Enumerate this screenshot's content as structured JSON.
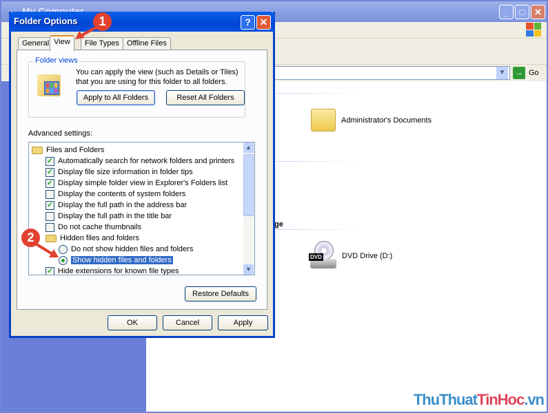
{
  "explorer": {
    "title": "My Computer",
    "address_go": "Go",
    "section_partial": "ge",
    "items": [
      {
        "label": "Administrator's Documents",
        "icon": "folder-icon"
      },
      {
        "label": "DVD Drive (D:)",
        "icon": "dvd-drive-icon"
      }
    ]
  },
  "dialog": {
    "title": "Folder Options",
    "help": "?",
    "close": "✕",
    "tabs": [
      "General",
      "View",
      "File Types",
      "Offline Files"
    ],
    "active_tab": "View",
    "folder_views": {
      "legend": "Folder views",
      "text": "You can apply the view (such as Details or Tiles) that you are using for this folder to all folders.",
      "apply_all": "Apply to All Folders",
      "reset_all": "Reset All Folders"
    },
    "advanced_label": "Advanced settings:",
    "advanced_items": [
      {
        "type": "folder",
        "label": "Files and Folders"
      },
      {
        "type": "checkbox",
        "label": "Automatically search for network folders and printers",
        "checked": true
      },
      {
        "type": "checkbox",
        "label": "Display file size information in folder tips",
        "checked": true
      },
      {
        "type": "checkbox",
        "label": "Display simple folder view in Explorer's Folders list",
        "checked": true
      },
      {
        "type": "checkbox",
        "label": "Display the contents of system folders",
        "checked": false
      },
      {
        "type": "checkbox",
        "label": "Display the full path in the address bar",
        "checked": true
      },
      {
        "type": "checkbox",
        "label": "Display the full path in the title bar",
        "checked": false
      },
      {
        "type": "checkbox",
        "label": "Do not cache thumbnails",
        "checked": false
      },
      {
        "type": "folder",
        "label": "Hidden files and folders"
      },
      {
        "type": "radio",
        "label": "Do not show hidden files and folders",
        "checked": false
      },
      {
        "type": "radio",
        "label": "Show hidden files and folders",
        "checked": true,
        "selected": true
      },
      {
        "type": "checkbox",
        "label": "Hide extensions for known file types",
        "checked": true
      }
    ],
    "restore_defaults": "Restore Defaults",
    "ok": "OK",
    "cancel": "Cancel",
    "apply": "Apply"
  },
  "annotations": {
    "step1": "1",
    "step2": "2",
    "color": "#e2412f"
  },
  "watermark": {
    "part1": "ThuThuat",
    "part2": "TinHoc",
    "part3": ".vn",
    "color1": "#3a8fc9",
    "color2": "#e0445a"
  }
}
